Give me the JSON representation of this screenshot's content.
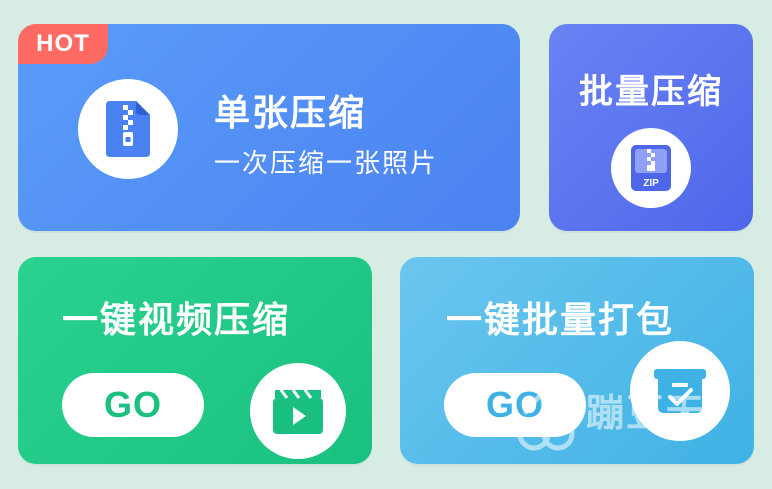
{
  "cards": {
    "single": {
      "badge": "HOT",
      "title": "单张压缩",
      "subtitle": "一次压缩一张照片",
      "icon": "zip-file-icon",
      "color": "#4b82f1"
    },
    "batch": {
      "title": "批量压缩",
      "icon": "zip-archive-icon",
      "icon_label": "ZIP",
      "color": "#4e67ea"
    },
    "video": {
      "title": "一键视频压缩",
      "go_label": "GO",
      "icon": "video-clapper-icon",
      "color": "#19c07f"
    },
    "pack": {
      "title": "一键批量打包",
      "go_label": "GO",
      "icon": "package-check-icon",
      "color": "#3fb2e5"
    }
  },
  "watermark": {
    "text": "蹦豆无"
  },
  "colors": {
    "background": "#d7ede3",
    "hot": "#ff6b63"
  }
}
